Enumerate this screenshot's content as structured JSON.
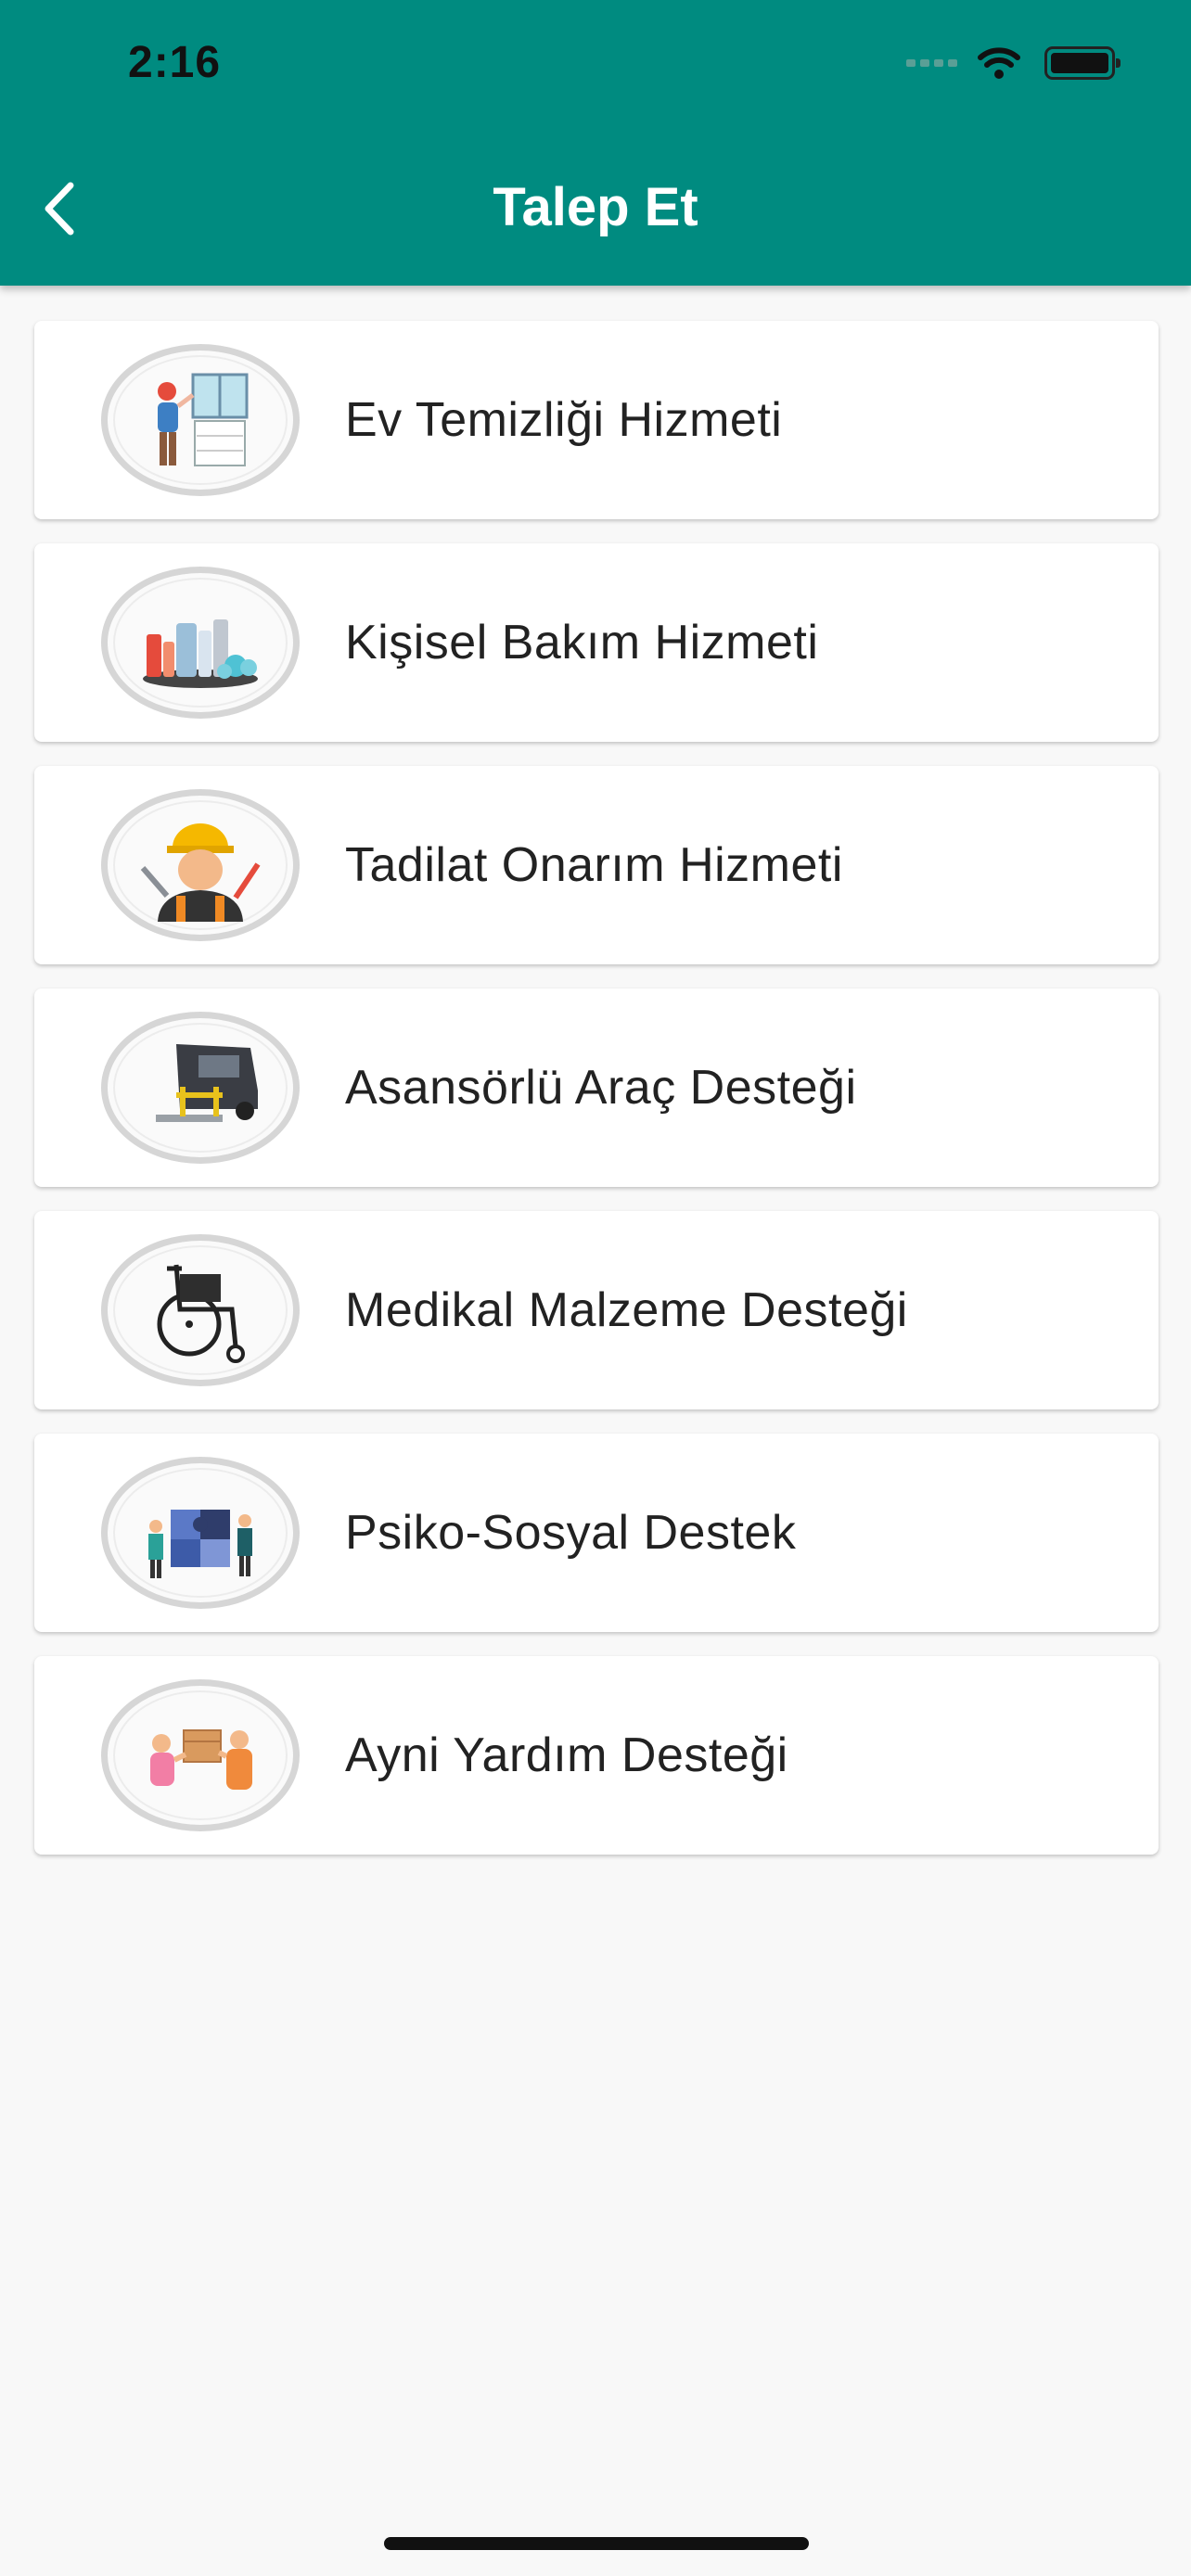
{
  "status_bar": {
    "time": "2:16"
  },
  "header": {
    "title": "Talep Et"
  },
  "services": [
    {
      "label": "Ev Temizliği Hizmeti",
      "icon": "house-cleaning-icon"
    },
    {
      "label": "Kişisel Bakım Hizmeti",
      "icon": "personal-care-icon"
    },
    {
      "label": "Tadilat Onarım Hizmeti",
      "icon": "repair-worker-icon"
    },
    {
      "label": "Asansörlü Araç Desteği",
      "icon": "lift-vehicle-icon"
    },
    {
      "label": "Medikal Malzeme Desteği",
      "icon": "wheelchair-icon"
    },
    {
      "label": "Psiko-Sosyal Destek",
      "icon": "puzzle-people-icon"
    },
    {
      "label": "Ayni Yardım Desteği",
      "icon": "aid-package-icon"
    }
  ],
  "colors": {
    "header": "#008b80",
    "background": "#f8f8f8",
    "card": "#ffffff"
  }
}
